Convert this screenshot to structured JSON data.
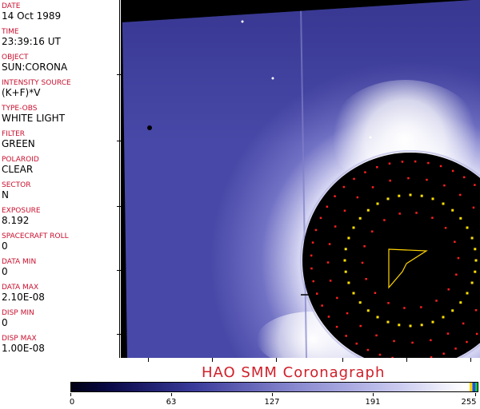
{
  "fields": [
    {
      "label": "DATE",
      "value": "14 Oct 1989"
    },
    {
      "label": "TIME",
      "value": "23:39:16 UT"
    },
    {
      "label": "OBJECT",
      "value": "SUN:CORONA"
    },
    {
      "label": "INTENSITY SOURCE",
      "value": "(K+F)*V"
    },
    {
      "label": "TYPE-OBS",
      "value": "WHITE LIGHT"
    },
    {
      "label": "FILTER",
      "value": "GREEN"
    },
    {
      "label": "POLAROID",
      "value": "CLEAR"
    },
    {
      "label": "SECTOR",
      "value": "N"
    },
    {
      "label": "EXPOSURE",
      "value": "8.192"
    },
    {
      "label": "SPACECRAFT ROLL",
      "value": "0"
    },
    {
      "label": "DATA MIN",
      "value": "0"
    },
    {
      "label": "DATA MAX",
      "value": "2.10E-08"
    },
    {
      "label": "DISP MIN",
      "value": "0"
    },
    {
      "label": "DISP MAX",
      "value": "1.00E-08"
    }
  ],
  "caption": "HAO  SMM Coronagraph",
  "colorbar": {
    "labels": [
      "0",
      "63",
      "127",
      "191",
      "255"
    ]
  },
  "colors": {
    "label_red": "#c8102e",
    "caption_red": "#d0202a",
    "corona_blue": "#5a5ab8"
  }
}
